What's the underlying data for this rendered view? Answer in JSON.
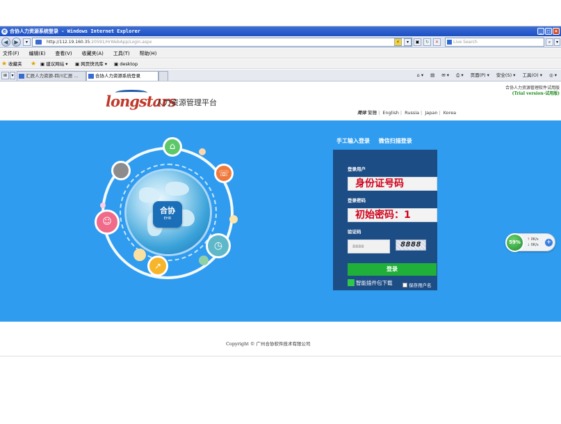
{
  "browser": {
    "title": "合协人力资源系统登录 - Windows Internet Explorer",
    "address_host": "http://112.19.160.35",
    "address_path": ":20591/HrWebApp/Login.aspx",
    "search_placeholder": "Live Search",
    "menu": [
      "文件(F)",
      "编辑(E)",
      "查看(V)",
      "收藏夹(A)",
      "工具(T)",
      "帮助(H)"
    ],
    "favorites": {
      "label": "收藏夹",
      "items": [
        "建议网站 ▾",
        "网页快讯库 ▾",
        "desktop"
      ]
    },
    "tabs": [
      {
        "label": "汇辰人力资源-四川汇辰 ...",
        "active": false
      },
      {
        "label": "合协人力资源系统登录",
        "active": true
      }
    ],
    "toolbar": [
      "页面(P) ▾",
      "安全(S) ▾",
      "工具(O) ▾",
      "◎ ▾"
    ]
  },
  "header": {
    "brand": "longstars",
    "platform": "人力资源管理平台",
    "tagline": "合协人力资源管理软件试用版",
    "trial": "(Trial version-试用版)",
    "languages": [
      "简体",
      "繁體",
      "English",
      "Russia",
      "Japan",
      "Korea"
    ],
    "selected_language": "简体"
  },
  "login": {
    "tabs": [
      "手工输入登录",
      "微信扫描登录"
    ],
    "user_label": "登录用户",
    "user_value": "身份证号码",
    "password_label": "登录密码",
    "password_value": "初始密码：1",
    "captcha_label": "验证码",
    "captcha_placeholder": "8888",
    "captcha_text": "8888",
    "login_button": "登录",
    "plugin_link": "智能插件包下载",
    "remember_label": "保存用户名"
  },
  "globe": {
    "badge": "合协",
    "badge_sub": "EHR"
  },
  "footer": {
    "copyright": "Copyright © 广州合协软件技术有限公司"
  },
  "net_monitor": {
    "percent": "59%",
    "up": "0K/s",
    "down": "0K/s"
  },
  "colors": {
    "banner": "#2f9cef",
    "login_panel": "#1d4d85",
    "login_button": "#20b03a",
    "hint_text": "#d0021b"
  }
}
